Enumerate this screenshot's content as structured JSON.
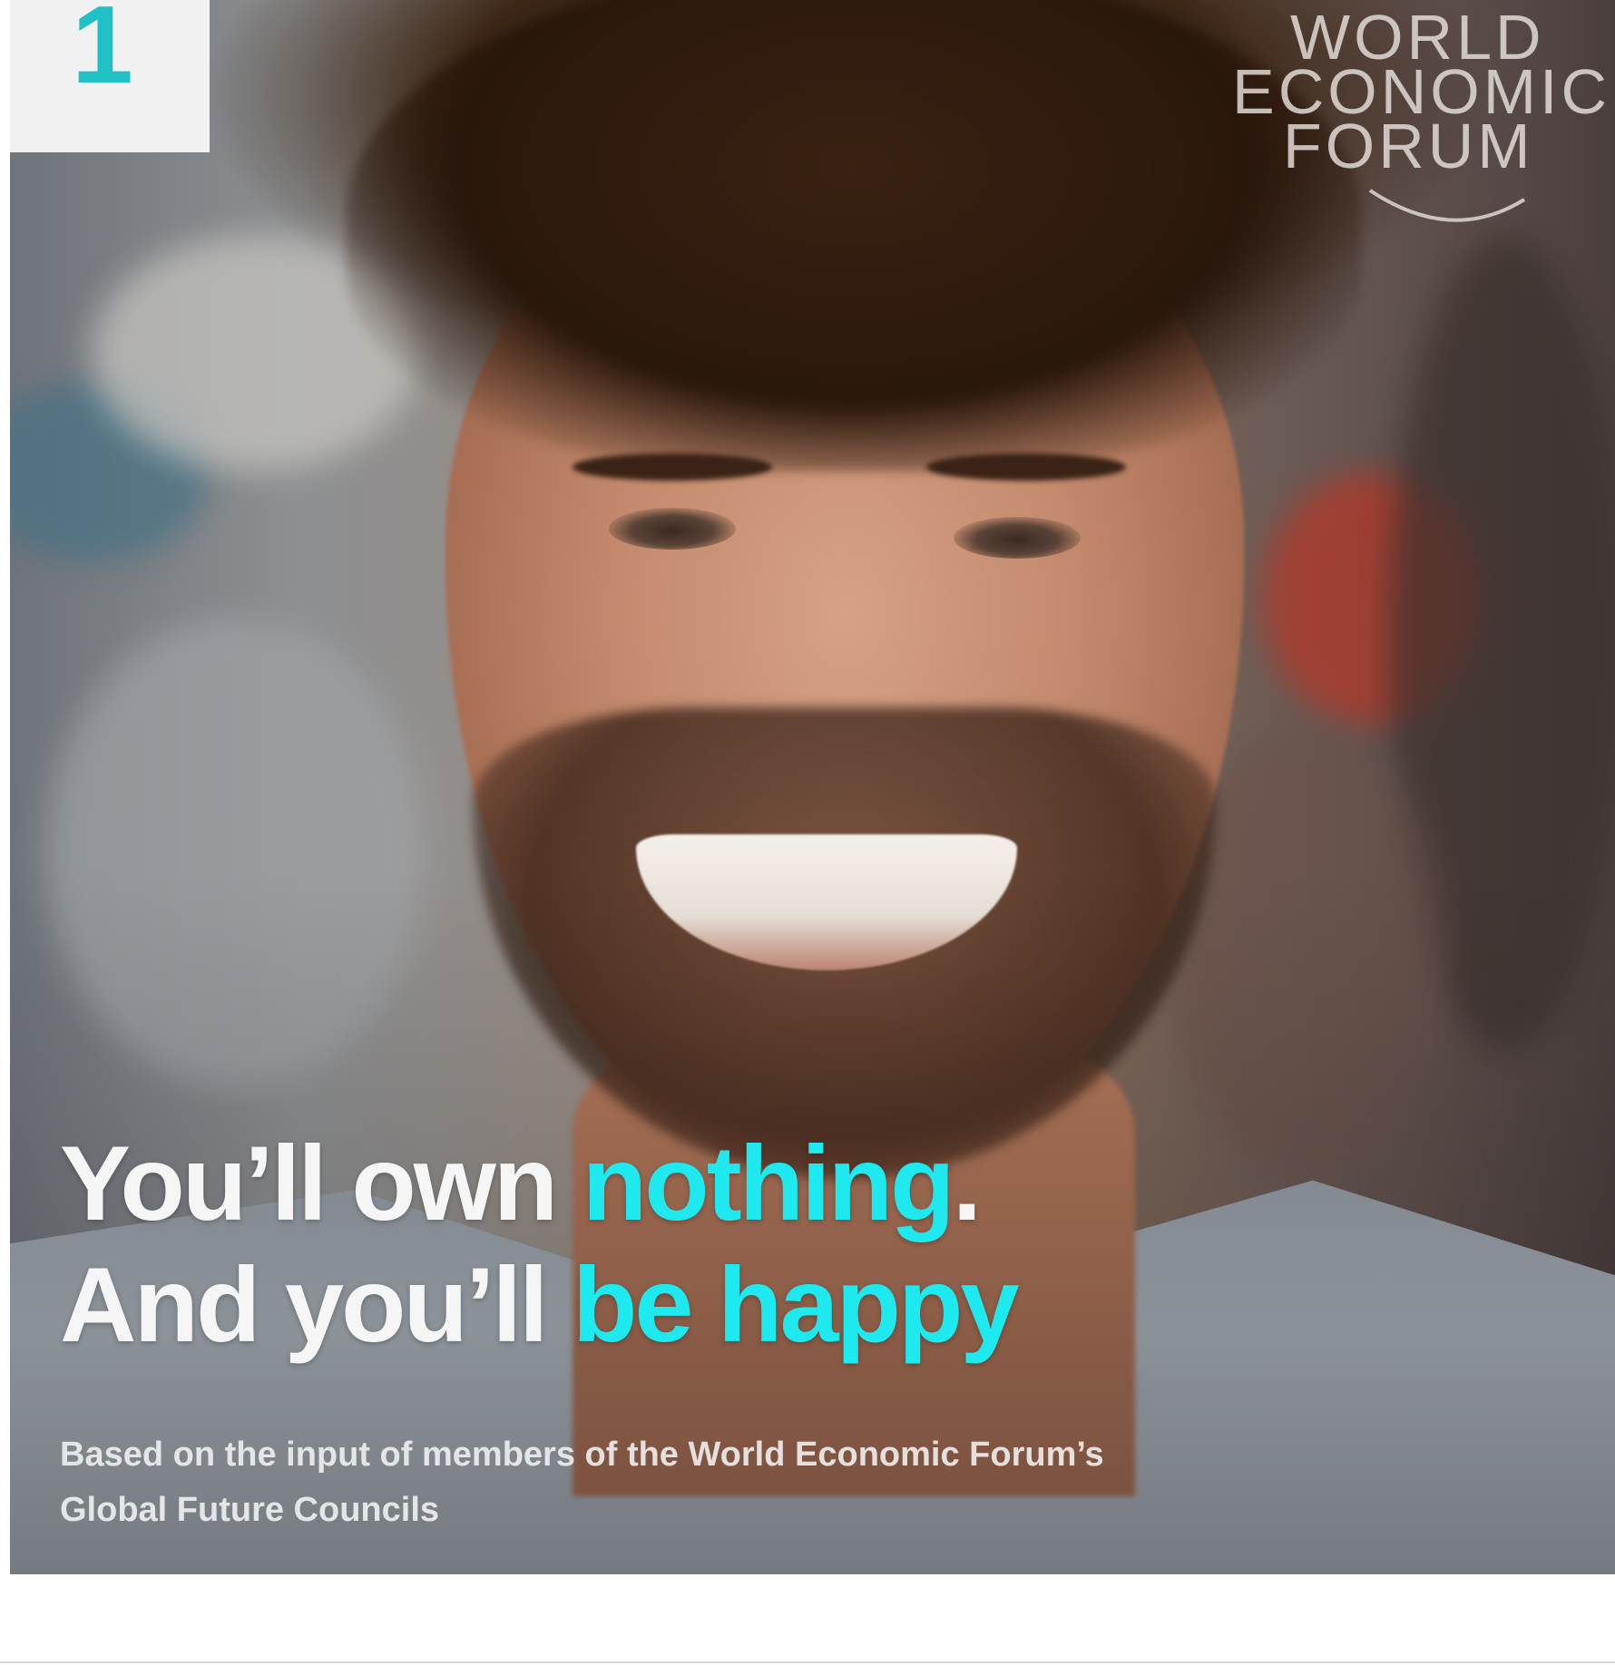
{
  "badge": {
    "number": "1",
    "color": "#1fc0c6"
  },
  "logo": {
    "lines": [
      "WORLD",
      "ECONOMIC",
      "FORUM"
    ]
  },
  "headline": {
    "line1": {
      "white": "You’ll own ",
      "accent": "nothing",
      "end": "."
    },
    "line2": {
      "white": "And you’ll ",
      "accent": "be happy"
    },
    "accent_color": "#1ee9ef"
  },
  "footnote": {
    "line1": "Based on the input of members of the World Economic Forum’s",
    "line2": "Global Future Councils"
  },
  "photo": {
    "subject": "smiling-man-portrait-icon"
  }
}
